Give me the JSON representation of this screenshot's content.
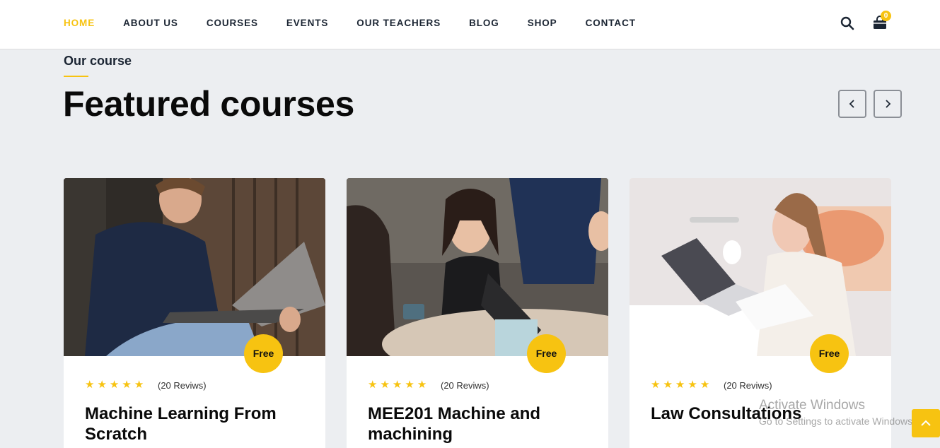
{
  "nav": {
    "items": [
      {
        "label": "HOME",
        "active": true
      },
      {
        "label": "ABOUT US"
      },
      {
        "label": "COURSES"
      },
      {
        "label": "EVENTS"
      },
      {
        "label": "OUR TEACHERS"
      },
      {
        "label": "BLOG"
      },
      {
        "label": "SHOP"
      },
      {
        "label": "CONTACT"
      }
    ],
    "search_icon": "search-icon",
    "cart_icon": "cart-icon",
    "cart_count": "0"
  },
  "section": {
    "subtitle": "Our course",
    "title": "Featured courses",
    "prev_icon": "chevron-left-icon",
    "next_icon": "chevron-right-icon"
  },
  "courses": [
    {
      "badge": "Free",
      "reviews": "(20 Reviws)",
      "rating": 5,
      "title": "Machine Learning From Scratch"
    },
    {
      "badge": "Free",
      "reviews": "(20 Reviws)",
      "rating": 5,
      "title": "MEE201 Machine and machining"
    },
    {
      "badge": "Free",
      "reviews": "(20 Reviws)",
      "rating": 5,
      "title": "Law Consultations"
    }
  ],
  "watermark": {
    "line1": "Activate Windows",
    "line2": "Go to Settings to activate Windows."
  },
  "scroll_top_icon": "chevron-up-icon",
  "colors": {
    "accent": "#f7c311",
    "nav_text": "#1b2533",
    "background": "#eceef1"
  }
}
